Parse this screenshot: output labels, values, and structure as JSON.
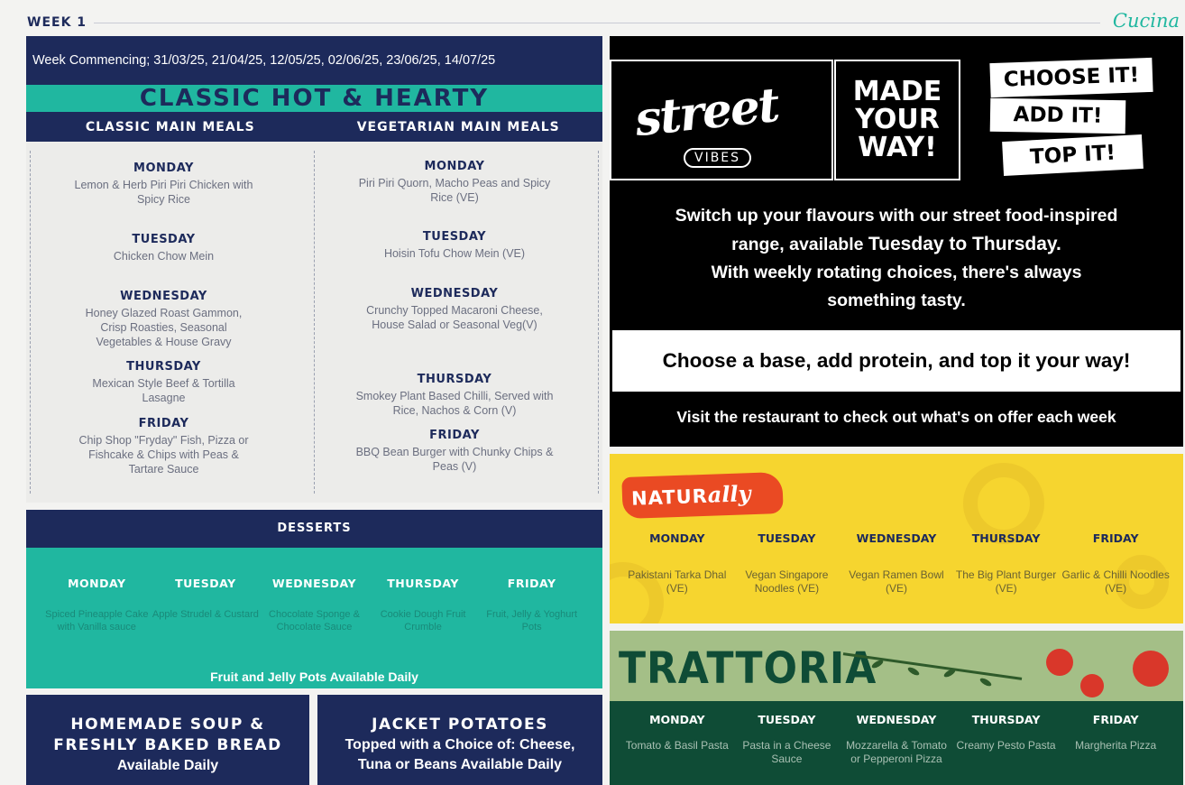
{
  "header": {
    "week": "WEEK 1",
    "brand": "Cucina"
  },
  "week_commencing": "Week Commencing; 31/03/25, 21/04/25, 12/05/25, 02/06/25, 23/06/25, 14/07/25",
  "classic": {
    "title": "CLASSIC HOT & HEARTY",
    "main_header": "CLASSIC MAIN MEALS",
    "veg_header": "VEGETARIAN MAIN MEALS",
    "main": [
      {
        "day": "MONDAY",
        "meal": "Lemon & Herb Piri Piri Chicken with Spicy Rice"
      },
      {
        "day": "TUESDAY",
        "meal": "Chicken Chow Mein"
      },
      {
        "day": "WEDNESDAY",
        "meal": "Honey Glazed Roast Gammon, Crisp Roasties, Seasonal Vegetables & House Gravy"
      },
      {
        "day": "THURSDAY",
        "meal": "Mexican Style Beef & Tortilla Lasagne"
      },
      {
        "day": "FRIDAY",
        "meal": "Chip Shop \"Fryday\" Fish, Pizza or Fishcake & Chips with Peas & Tartare Sauce"
      }
    ],
    "veg": [
      {
        "day": "MONDAY",
        "meal": "Piri Piri Quorn, Macho Peas and Spicy Rice (VE)"
      },
      {
        "day": "TUESDAY",
        "meal": "Hoisin Tofu Chow Mein (VE)"
      },
      {
        "day": "WEDNESDAY",
        "meal": "Crunchy Topped Macaroni Cheese, House Salad or Seasonal Veg(V)"
      },
      {
        "day": "THURSDAY",
        "meal": "Smokey Plant Based Chilli, Served with Rice, Nachos & Corn (V)"
      },
      {
        "day": "FRIDAY",
        "meal": "BBQ Bean Burger with Chunky Chips & Peas (V)"
      }
    ]
  },
  "desserts": {
    "title": "DESSERTS",
    "days": [
      {
        "day": "MONDAY",
        "item": "Spiced Pineapple Cake with Vanilla sauce"
      },
      {
        "day": "TUESDAY",
        "item": "Apple Strudel & Custard"
      },
      {
        "day": "WEDNESDAY",
        "item": "Chocolate Sponge & Chocolate Sauce"
      },
      {
        "day": "THURSDAY",
        "item": "Cookie Dough Fruit Crumble"
      },
      {
        "day": "FRIDAY",
        "item": "Fruit, Jelly & Yoghurt Pots"
      }
    ],
    "footer": "Fruit and Jelly Pots Available Daily"
  },
  "soup": {
    "line1": "HOMEMADE SOUP &",
    "line2": "FRESHLY BAKED BREAD",
    "sub": "Available Daily"
  },
  "jacket": {
    "title": "JACKET POTATOES",
    "sub1": "Topped with a Choice of: Cheese,",
    "sub2": "Tuna or Beans Available Daily"
  },
  "street": {
    "logo_word": "street",
    "logo_sub": "VIBES",
    "made1": "MADE",
    "made2": "YOUR",
    "made3": "WAY!",
    "tags": [
      "CHOOSE IT!",
      "ADD IT!",
      "TOP IT!"
    ],
    "copy_1": "Switch up your flavours with our street food-inspired",
    "copy_2a": "range, available ",
    "copy_2b": "Tuesday to Thursday.",
    "copy_3": "With weekly rotating choices, there's always",
    "copy_4": "something tasty.",
    "choose": "Choose a base, add protein, and top it your way!",
    "visit": "Visit the restaurant to check out what's on offer each week"
  },
  "naturally": {
    "badge_a": "NATUR",
    "badge_b": "ally",
    "days": [
      {
        "day": "MONDAY",
        "item": "Pakistani Tarka Dhal (VE)"
      },
      {
        "day": "TUESDAY",
        "item": "Vegan Singapore Noodles (VE)"
      },
      {
        "day": "WEDNESDAY",
        "item": "Vegan Ramen Bowl (VE)"
      },
      {
        "day": "THURSDAY",
        "item": "The Big Plant Burger (VE)"
      },
      {
        "day": "FRIDAY",
        "item": "Garlic & Chilli Noodles (VE)"
      }
    ]
  },
  "trattoria": {
    "title": "TRATTORIA",
    "days": [
      {
        "day": "MONDAY",
        "item": "Tomato & Basil Pasta"
      },
      {
        "day": "TUESDAY",
        "item": "Pasta in a Cheese Sauce"
      },
      {
        "day": "WEDNESDAY",
        "item": "Mozzarella & Tomato or Pepperoni Pizza"
      },
      {
        "day": "THURSDAY",
        "item": "Creamy Pesto Pasta"
      },
      {
        "day": "FRIDAY",
        "item": "Margherita Pizza"
      }
    ]
  },
  "colors": {
    "navy": "#1d2a5b",
    "teal": "#20b7a0",
    "yellow": "#f6d52f",
    "green": "#0f4c36",
    "orange": "#ea4a23"
  }
}
